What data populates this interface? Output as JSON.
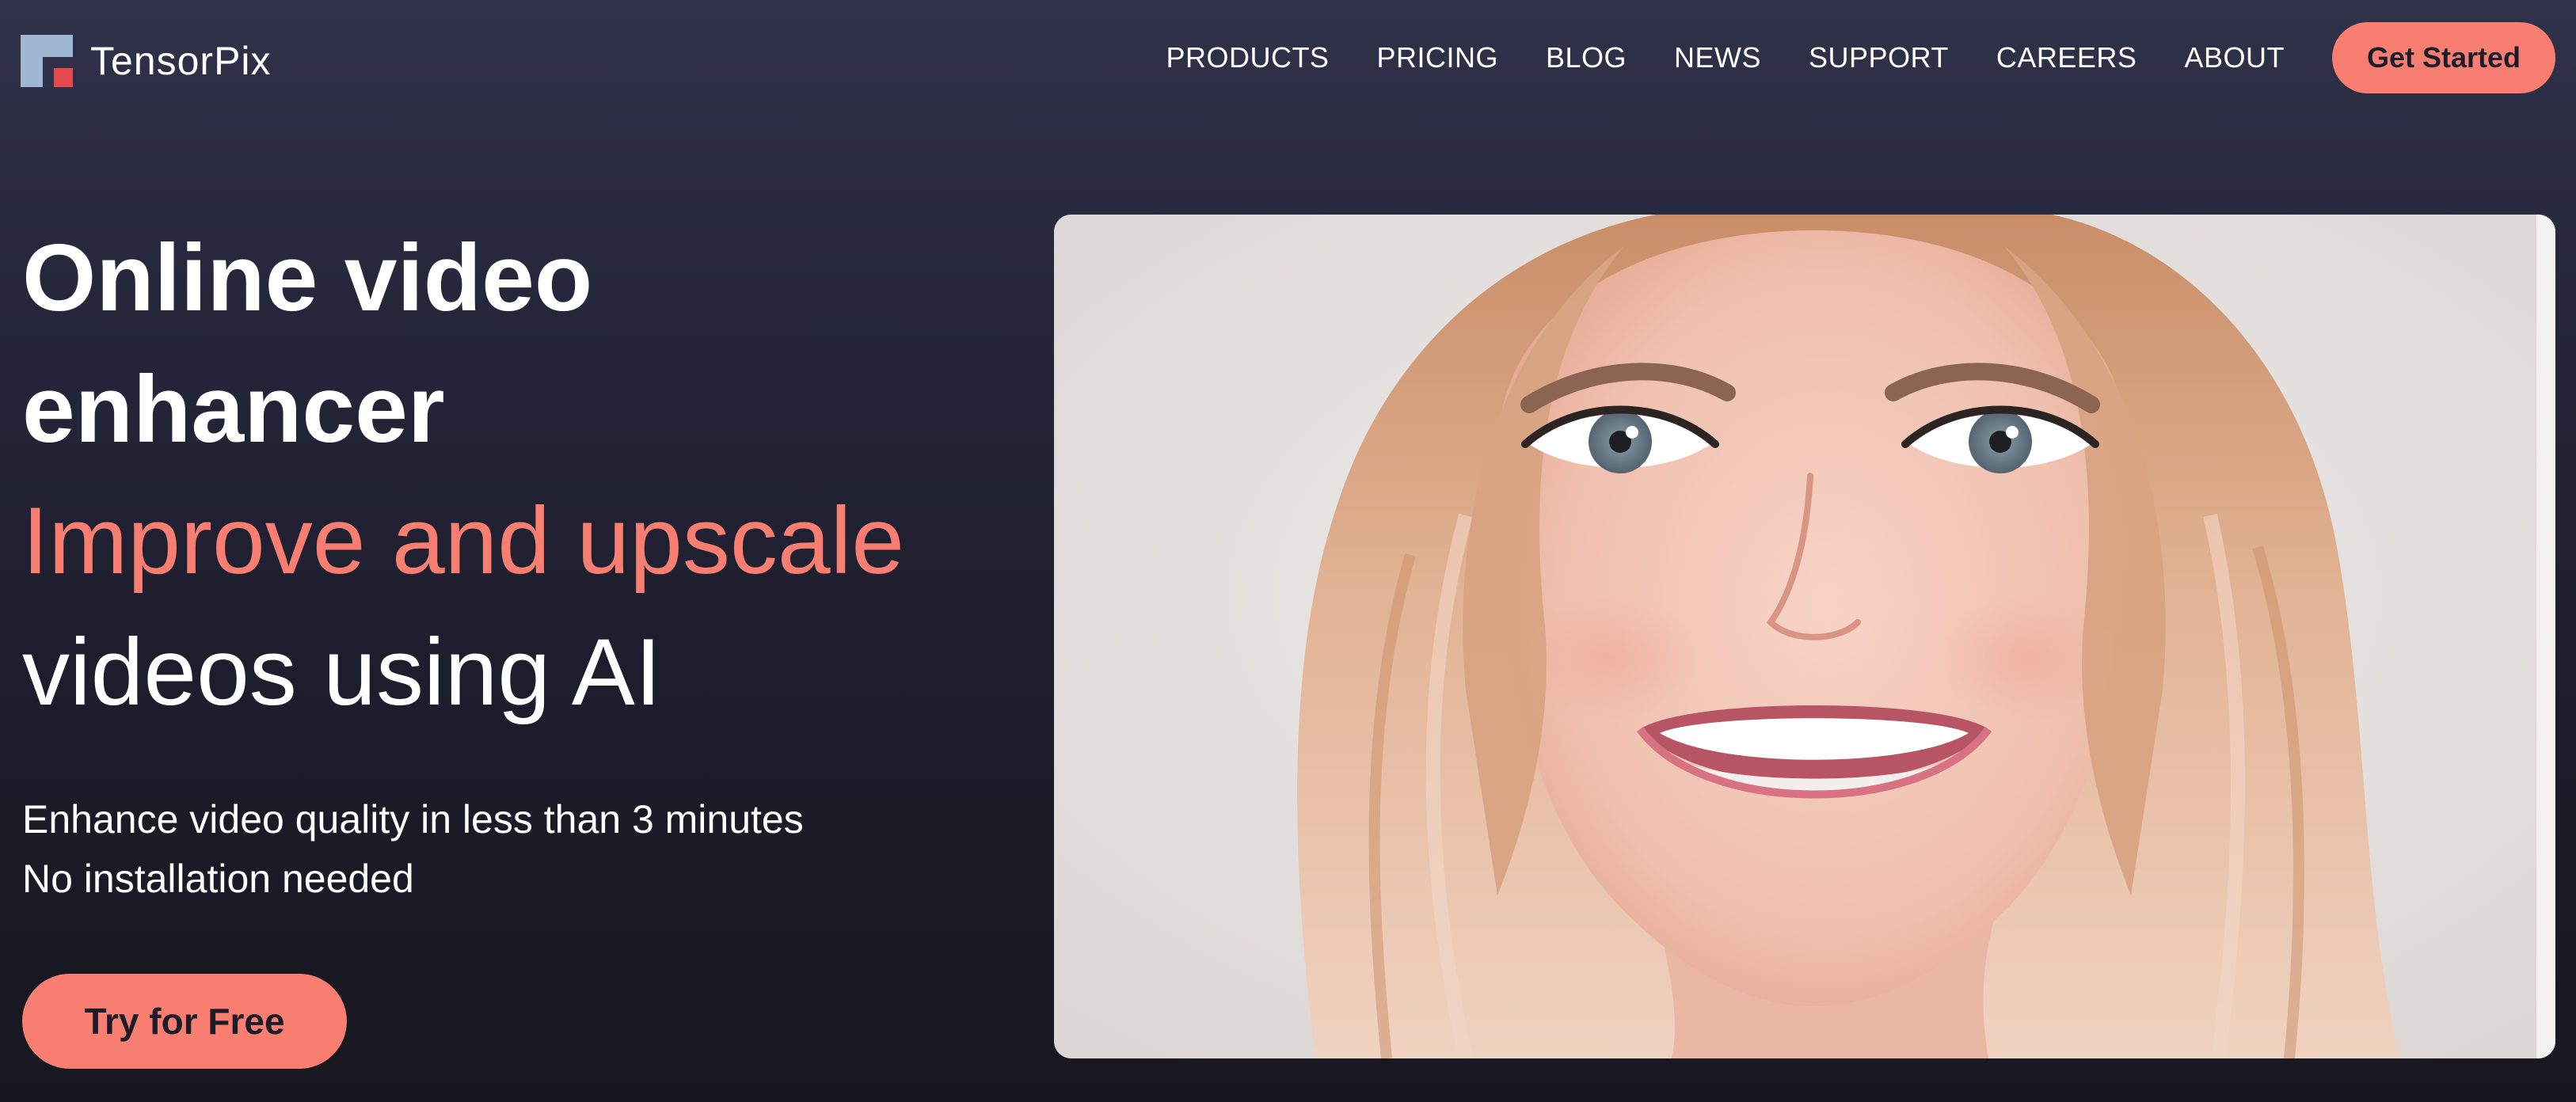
{
  "brand": {
    "name": "TensorPix",
    "logo_icon": "tensorpix-logo-icon"
  },
  "nav": {
    "items": [
      {
        "label": "PRODUCTS"
      },
      {
        "label": "PRICING"
      },
      {
        "label": "BLOG"
      },
      {
        "label": "NEWS"
      },
      {
        "label": "SUPPORT"
      },
      {
        "label": "CAREERS"
      },
      {
        "label": "ABOUT"
      }
    ],
    "cta_label": "Get Started"
  },
  "hero": {
    "title_line1": "Online video",
    "title_line2": "enhancer",
    "accent_line": "Improve and upscale",
    "title_line4": "videos using AI",
    "subtitle_line1": "Enhance video quality in less than 3 minutes",
    "subtitle_line2": "No installation needed",
    "cta_label": "Try for Free"
  },
  "colors": {
    "accent": "#f77e70",
    "background_top": "#30324a",
    "background_bottom": "#17171f",
    "logo_blue": "#9fb7d3",
    "logo_red": "#e5484d"
  }
}
